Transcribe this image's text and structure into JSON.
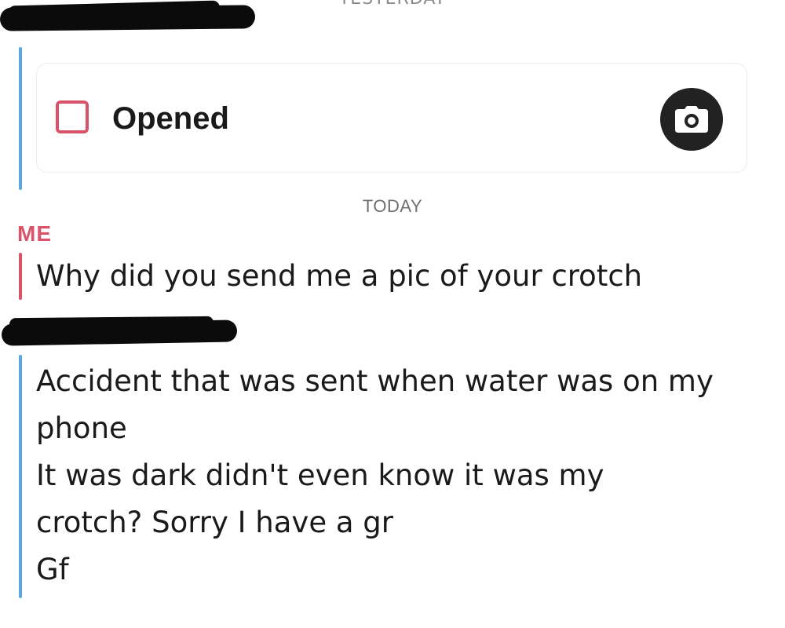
{
  "chat": {
    "date_yesterday": "YESTERDAY",
    "snap": {
      "status": "Opened",
      "status_color": "#d9546a",
      "camera_icon": "camera-icon"
    },
    "date_today": "TODAY",
    "my_label": "ME",
    "my_message": "Why did you send me a pic of your crotch",
    "their_message_lines": [
      "Accident that was sent when water was on my",
      "phone",
      "It was dark didn't even know it was my",
      "crotch? Sorry I have a gr",
      "Gf"
    ]
  },
  "colors": {
    "me_accent": "#d9546a",
    "friend_accent": "#5aa8dc"
  }
}
